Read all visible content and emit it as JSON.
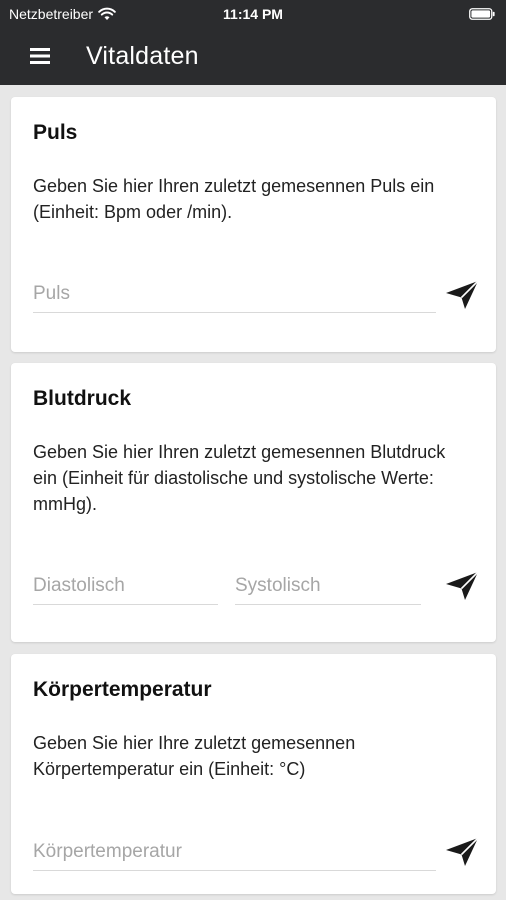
{
  "status_bar": {
    "carrier": "Netzbetreiber",
    "time": "11:14 PM",
    "icons": [
      "wifi-icon",
      "battery-icon"
    ]
  },
  "app_bar": {
    "title": "Vitaldaten",
    "menu_icon": "menu-icon"
  },
  "colors": {
    "app_bar_bg": "#2b2c2e",
    "page_bg": "#e7e7e7",
    "card_bg": "#ffffff",
    "placeholder": "#a6a6a6",
    "divider": "#d9d9d9"
  },
  "cards": [
    {
      "title": "Puls",
      "description": "Geben Sie hier Ihren zuletzt gemesennen Puls ein (Einheit: Bpm oder /min).",
      "fields": [
        {
          "placeholder": "Puls",
          "value": ""
        }
      ],
      "send_icon": "send-icon"
    },
    {
      "title": "Blutdruck",
      "description": "Geben Sie hier Ihren zuletzt gemesennen Blutdruck ein (Einheit für diastolische und systolische Werte: mmHg).",
      "fields": [
        {
          "placeholder": "Diastolisch",
          "value": ""
        },
        {
          "placeholder": "Systolisch",
          "value": ""
        }
      ],
      "send_icon": "send-icon"
    },
    {
      "title": "Körpertemperatur",
      "description": "Geben Sie hier Ihre zuletzt gemesennen Körpertemperatur ein (Einheit: °C)",
      "fields": [
        {
          "placeholder": "Körpertemperatur",
          "value": ""
        }
      ],
      "send_icon": "send-icon"
    }
  ]
}
